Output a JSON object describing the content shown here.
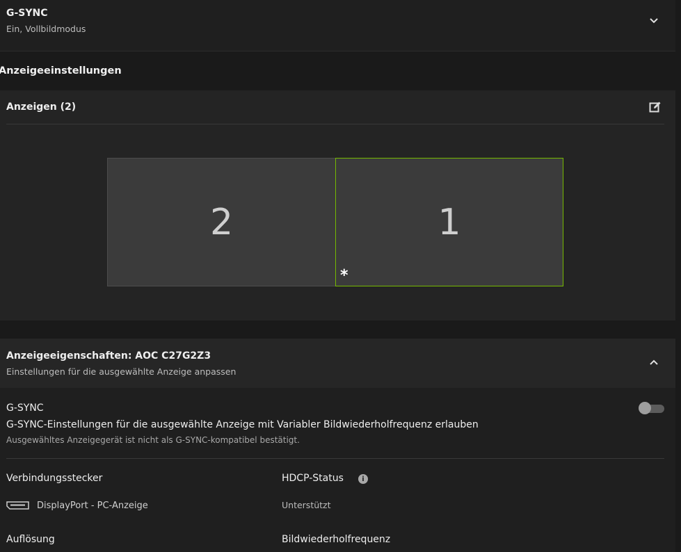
{
  "gsync_top": {
    "title": "G-SYNC",
    "subtitle": "Ein, Vollbildmodus",
    "chevron_icon": "chevron-down-icon"
  },
  "section_heading": "Anzeigeeinstellungen",
  "displays": {
    "title": "Anzeigen (2)",
    "edit_icon": "edit-icon",
    "monitors": [
      {
        "label": "2",
        "selected": false
      },
      {
        "label": "1",
        "selected": true,
        "primary_marker": "*"
      }
    ],
    "selected_border_color": "#76b900"
  },
  "properties": {
    "title": "Anzeigeeigenschaften: AOC C27G2Z3",
    "subtitle": "Einstellungen für die ausgewählte Anzeige anpassen",
    "chevron_icon": "chevron-up-icon",
    "gsync": {
      "label": "G-SYNC",
      "description": "G-SYNC-Einstellungen für die ausgewählte Anzeige mit Variabler Bildwiederholfrequenz erlauben",
      "note": "Ausgewähltes Anzeigegerät ist nicht als G-SYNC-kompatibel bestätigt.",
      "enabled": false
    },
    "connector": {
      "label": "Verbindungsstecker",
      "icon": "displayport-icon",
      "value": "DisplayPort - PC-Anzeige"
    },
    "hdcp": {
      "label": "HDCP-Status",
      "info_icon": "info-icon",
      "value": "Unterstützt"
    },
    "resolution_label": "Auflösung",
    "refresh_label": "Bildwiederholfrequenz"
  }
}
